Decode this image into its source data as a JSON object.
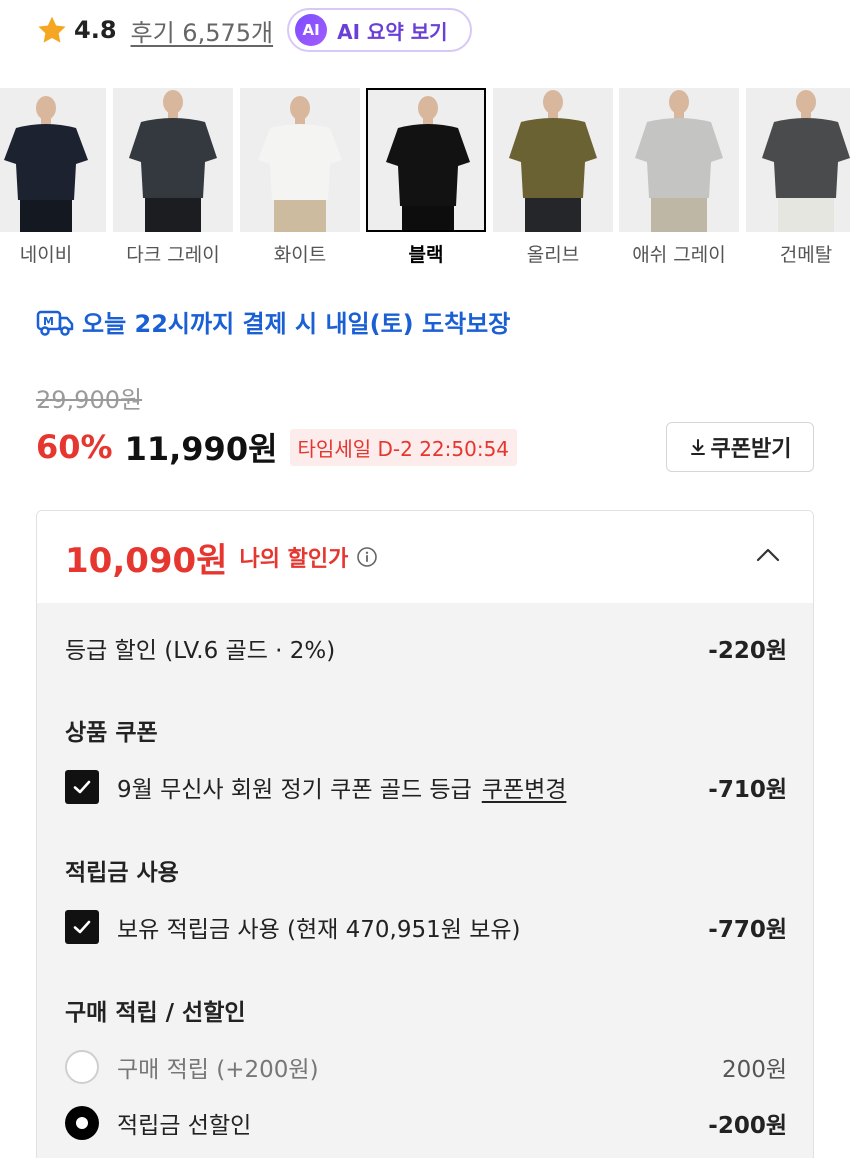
{
  "rating": {
    "score": "4.8",
    "reviews_label": "후기 6,575개",
    "ai_badge": "AI",
    "ai_label": "AI 요약 보기"
  },
  "colors": [
    {
      "name": "네이비",
      "shirt": "#1c2230",
      "pants": "#141820",
      "selected": false
    },
    {
      "name": "다크 그레이",
      "shirt": "#33393f",
      "pants": "#1b1d20",
      "selected": false
    },
    {
      "name": "화이트",
      "shirt": "#f4f4f2",
      "pants": "#cdbba0",
      "selected": false
    },
    {
      "name": "블랙",
      "shirt": "#121212",
      "pants": "#0d0d0d",
      "selected": true
    },
    {
      "name": "올리브",
      "shirt": "#6b6233",
      "pants": "#24262a",
      "selected": false
    },
    {
      "name": "애쉬 그레이",
      "shirt": "#c4c5c3",
      "pants": "#bfb7a6",
      "selected": false
    },
    {
      "name": "건메탈",
      "shirt": "#4a4b4d",
      "pants": "#e5e6e0",
      "selected": false
    }
  ],
  "delivery": {
    "text": "오늘 22시까지 결제 시 내일(토) 도착보장",
    "color": "#1a5fd4"
  },
  "price": {
    "original": "29,900원",
    "discount": "60%",
    "sale": "11,990원",
    "timesale": "타임세일 D-2 22:50:54",
    "coupon_button": "쿠폰받기"
  },
  "my_discount": {
    "price": "10,090원",
    "label": "나의 할인가",
    "grade": {
      "label": "등급 할인 (LV.6 골드 · 2%)",
      "amount": "-220원"
    },
    "product_coupon": {
      "title": "상품 쿠폰",
      "item": "9월 무신사 회원 정기 쿠폰 골드 등급",
      "change_link": "쿠폰변경",
      "amount": "-710원"
    },
    "points": {
      "title": "적립금 사용",
      "item": "보유 적립금 사용 (현재 470,951원 보유)",
      "amount": "-770원"
    },
    "reward": {
      "title": "구매 적립 / 선할인",
      "option1": {
        "label": "구매 적립 (+200원)",
        "amount": "200원"
      },
      "option2": {
        "label": "적립금 선할인",
        "amount": "-200원"
      }
    }
  },
  "accent_red": "#e5362f"
}
